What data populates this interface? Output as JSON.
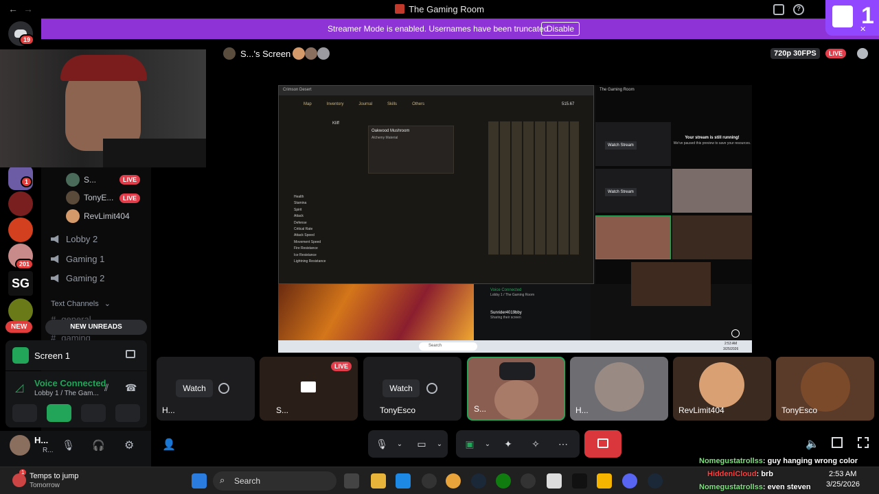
{
  "window": {
    "title": "The Gaming Room"
  },
  "banner": {
    "message": "Streamer Mode is enabled. Usernames have been truncated.",
    "disable_label": "Disable"
  },
  "rail": {
    "home_badge": "19",
    "badge_1": "1",
    "badge_201": "201",
    "new_label": "NEW"
  },
  "stage": {
    "screen_owner": "S...'s Screen",
    "quality": "720p 30FPS",
    "live": "LIVE"
  },
  "voice_members": [
    {
      "name": "S...",
      "live": "LIVE"
    },
    {
      "name": "TonyE...",
      "live": "LIVE"
    },
    {
      "name": "RevLimit404"
    }
  ],
  "channels": {
    "voice": [
      "Lobby 2",
      "Gaming 1",
      "Gaming 2"
    ],
    "text_header": "Text Channels",
    "text": [
      "general",
      "gaming"
    ],
    "new_unreads": "NEW UNREADS"
  },
  "screen_panel": {
    "title": "Screen 1"
  },
  "voice_panel": {
    "status": "Voice Connected",
    "location": "Lobby 1 / The Gam..."
  },
  "user_panel": {
    "name": "H...",
    "sub": "R..."
  },
  "tiles": [
    {
      "label": "H...",
      "watch": "Watch"
    },
    {
      "label": "S...",
      "live": "LIVE"
    },
    {
      "label": "TonyEsco",
      "watch": "Watch"
    },
    {
      "label": "S..."
    },
    {
      "label": "H..."
    },
    {
      "label": "RevLimit404"
    },
    {
      "label": "TonyEsco"
    }
  ],
  "share": {
    "game_title": "Crimson Desert",
    "tabs": [
      "Map",
      "Inventory",
      "Journal",
      "Skills",
      "Others"
    ],
    "character": "Kliff",
    "item_name": "Oakwood Mushroom",
    "item_type": "Alchemy Material",
    "currency": "515.67",
    "inner_title": "The Gaming Room",
    "watch_stream": "Watch Stream",
    "stream_running": "Your stream is still running!",
    "stream_paused": "We've paused this preview to save your resources.",
    "stats": [
      "Health",
      "Stamina",
      "Spirit",
      "Attack",
      "Defense",
      "Critical Rate",
      "Attack Speed",
      "Movement Speed",
      "Fire Resistance",
      "Ice Resistance",
      "Lightning Resistance"
    ],
    "inner_voice": "Voice Connected",
    "inner_voice_loc": "Lobby 1 / The Gaming Room",
    "inner_user": "Sunrider4019bby",
    "inner_user_sub": "Sharing their screen",
    "inner_search": "Search",
    "inner_time": "2:53 AM",
    "inner_date": "3/25/2026"
  },
  "taskbar": {
    "weather_title": "Temps to jump",
    "weather_sub": "Tomorrow",
    "weather_badge": "1",
    "search": "Search",
    "time": "2:53 AM",
    "date": "3/25/2026"
  },
  "chat": [
    {
      "user": "Nomegustatrollss",
      "text": ": guy hanging wrong color",
      "color": "#7ee07e"
    },
    {
      "user": "HiddeniCloud",
      "text": ": brb",
      "color": "#ff4040"
    },
    {
      "user": "Nomegustatrollss",
      "text": ": even steven",
      "color": "#7ee07e"
    }
  ],
  "overlay": {
    "count": "1"
  },
  "colors": {
    "banner": "#8e34d6",
    "live": "#e23d4a",
    "voice_green": "#23a559",
    "end_call": "#da373c"
  }
}
